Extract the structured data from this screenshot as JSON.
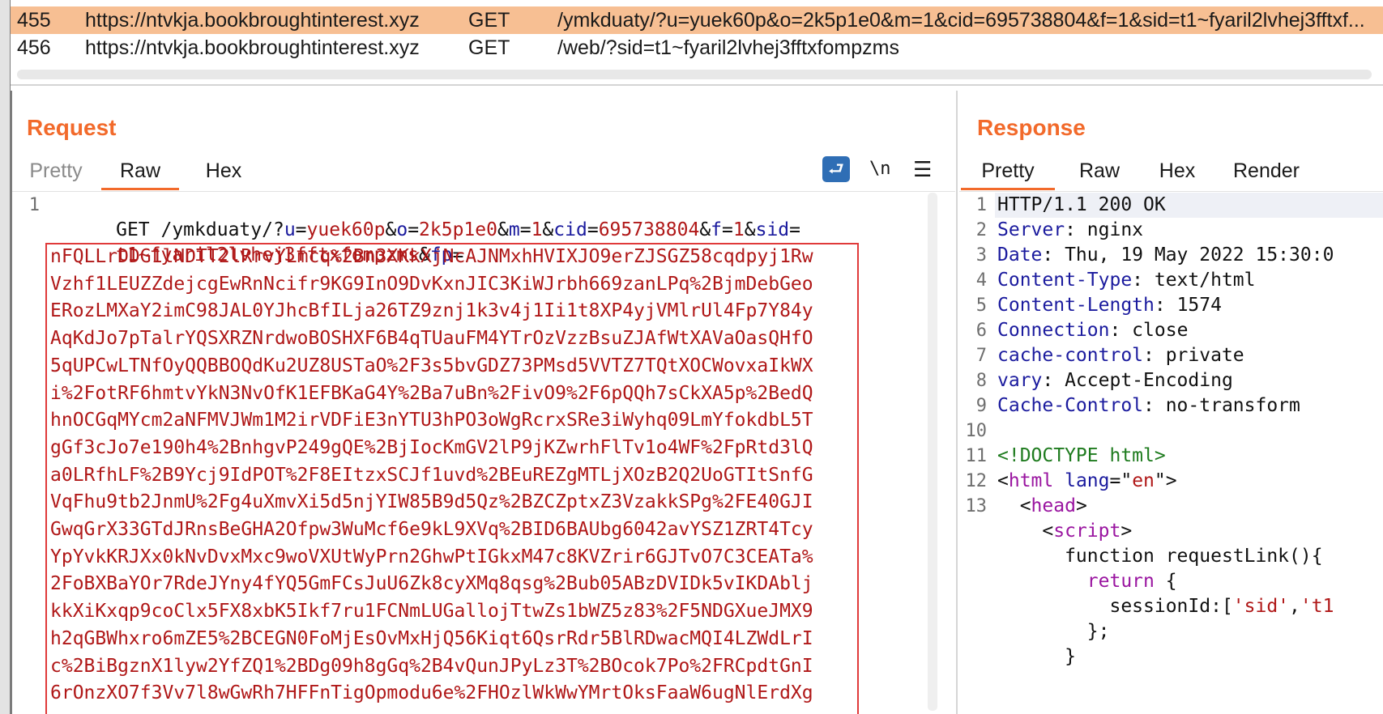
{
  "history": {
    "rows": [
      {
        "id": "455",
        "host": "https://ntvkja.bookbroughtinterest.xyz",
        "method": "GET",
        "url": "/ymkduaty/?u=yuek60p&o=2k5p1e0&m=1&cid=695738804&f=1&sid=t1~fyaril2lvhej3fftxf...",
        "selected": true
      },
      {
        "id": "456",
        "host": "https://ntvkja.bookbroughtinterest.xyz",
        "method": "GET",
        "url": "/web/?sid=t1~fyaril2lvhej3fftxfompzms",
        "selected": false
      }
    ]
  },
  "request": {
    "title": "Request",
    "tabs": [
      "Pretty",
      "Raw",
      "Hex"
    ],
    "active_tab": "Raw",
    "tools": {
      "wrap_icon": "wrap-lines-icon",
      "newline_label": "\\n",
      "menu_icon": "hamburger-menu-icon"
    },
    "line1_method": "GET /ymkduaty/?",
    "params": [
      {
        "k": "u",
        "v": "yuek60p"
      },
      {
        "k": "o",
        "v": "2k5p1e0"
      },
      {
        "k": "m",
        "v": "1"
      },
      {
        "k": "cid",
        "v": "695738804"
      },
      {
        "k": "f",
        "v": "1"
      },
      {
        "k": "sid",
        "v": ""
      }
    ],
    "line1_cont": "t1~fyaril2lvhej3fftxfompzms",
    "line1_cont_key": "fp",
    "fp_lines": [
      "nFQLLrDDG1lNDTT2lRrvYLmcq%2Bn3XKkXjNcAJNMxhHVIXJO9erZJSGZ58cqdpyj1Rw",
      "Vzhf1LEUZZdejcgEwRnNcifr9KG9InO9DvKxnJIC3KiWJrbh669zanLPq%2BjmDebGeo",
      "ERozLMXaY2imC98JAL0YJhcBfILja26TZ9znj1k3v4j1Ii1t8XP4yjVMlrUl4Fp7Y84y",
      "AqKdJo7pTalrYQSXRZNrdwoBOSHXF6B4qTUauFM4YTrOzVzzBsuZJAfWtXAVaOasQHfO",
      "5qUPCwLTNfOyQQBBOQdKu2UZ8USTaO%2F3s5bvGDZ73PMsd5VVTZ7TQtXOCWovxaIkWX",
      "i%2FotRF6hmtvYkN3NvOfK1EFBKaG4Y%2Ba7uBn%2FivO9%2F6pQQh7sCkXA5p%2BedQ",
      "hnOCGqMYcm2aNFMVJWm1M2irVDFiE3nYTU3hPO3oWgRcrxSRe3iWyhq09LmYfokdbL5T",
      "gGf3cJo7e190h4%2BnhgvP249gQE%2BjIocKmGV2lP9jKZwrhFlTv1o4WF%2FpRtd3lQ",
      "a0LRfhLF%2B9Ycj9IdPOT%2F8EItzxSCJf1uvd%2BEuREZgMTLjXOzB2Q2UoGTItSnfG",
      "VqFhu9tb2JnmU%2Fg4uXmvXi5d5njYIW85B9d5Qz%2BZCZptxZ3VzakkSPg%2FE40GJI",
      "GwqGrX33GTdJRnsBeGHA2Ofpw3WuMcf6e9kL9XVq%2BID6BAUbg6042avYSZ1ZRT4Tcy",
      "YpYvkKRJXx0kNvDvxMxc9woVXUtWyPrn2GhwPtIGkxM47c8KVZrir6GJTvO7C3CEATa%",
      "2FoBXBaYOr7RdeJYny4fYQ5GmFCsJuU6Zk8cyXMq8qsg%2Bub05ABzDVIDk5vIKDAblj",
      "kkXiKxqp9coClx5FX8xbK5Ikf7ru1FCNmLUGallojTtwZs1bWZ5z83%2F5NDGXueJMX9",
      "h2qGBWhxro6mZE5%2BCEGN0FoMjEsOvMxHjQ56Kiqt6QsrRdr5BlRDwacMQI4LZWdLrI",
      "c%2BiBgznX1lyw2YfZQ1%2BDg09h8gGq%2B4vQunJPyLz3T%2BOcok7Po%2FRCpdtGnI",
      "6rOnzXO7f3Vv7l8wGwRh7HFFnTigOpmodu6e%2FHOzlWkWwYMrtOksFaaW6ugNlErdXg"
    ]
  },
  "response": {
    "title": "Response",
    "tabs": [
      "Pretty",
      "Raw",
      "Hex",
      "Render"
    ],
    "active_tab": "Pretty",
    "lines": [
      {
        "n": "1",
        "parts": [
          {
            "c": "t",
            "s": "HTTP/1.1 200 OK"
          }
        ]
      },
      {
        "n": "2",
        "parts": [
          {
            "c": "k",
            "s": "Server"
          },
          {
            "c": "t",
            "s": ": nginx"
          }
        ]
      },
      {
        "n": "3",
        "parts": [
          {
            "c": "k",
            "s": "Date"
          },
          {
            "c": "t",
            "s": ": Thu, 19 May 2022 15:30:0"
          }
        ]
      },
      {
        "n": "4",
        "parts": [
          {
            "c": "k",
            "s": "Content-Type"
          },
          {
            "c": "t",
            "s": ": text/html"
          }
        ]
      },
      {
        "n": "5",
        "parts": [
          {
            "c": "k",
            "s": "Content-Length"
          },
          {
            "c": "t",
            "s": ": 1574"
          }
        ]
      },
      {
        "n": "6",
        "parts": [
          {
            "c": "k",
            "s": "Connection"
          },
          {
            "c": "t",
            "s": ": close"
          }
        ]
      },
      {
        "n": "7",
        "parts": [
          {
            "c": "k",
            "s": "cache-control"
          },
          {
            "c": "t",
            "s": ": private"
          }
        ]
      },
      {
        "n": "8",
        "parts": [
          {
            "c": "k",
            "s": "vary"
          },
          {
            "c": "t",
            "s": ": Accept-Encoding"
          }
        ]
      },
      {
        "n": "9",
        "parts": [
          {
            "c": "k",
            "s": "Cache-Control"
          },
          {
            "c": "t",
            "s": ": no-transform"
          }
        ]
      },
      {
        "n": "10",
        "parts": []
      },
      {
        "n": "11",
        "parts": [
          {
            "c": "g",
            "s": "<!DOCTYPE html>"
          }
        ]
      },
      {
        "n": "12",
        "parts": [
          {
            "c": "t",
            "s": "<"
          },
          {
            "c": "p",
            "s": "html"
          },
          {
            "c": "k",
            "s": " lang"
          },
          {
            "c": "t",
            "s": "=\""
          },
          {
            "c": "v",
            "s": "en"
          },
          {
            "c": "t",
            "s": "\">"
          }
        ]
      },
      {
        "n": "13",
        "parts": [
          {
            "c": "t",
            "s": "  <"
          },
          {
            "c": "p",
            "s": "head"
          },
          {
            "c": "t",
            "s": ">"
          }
        ]
      },
      {
        "n": "",
        "parts": [
          {
            "c": "t",
            "s": "    <"
          },
          {
            "c": "p",
            "s": "script"
          },
          {
            "c": "t",
            "s": ">"
          }
        ]
      },
      {
        "n": "",
        "parts": [
          {
            "c": "t",
            "s": "      function requestLink(){"
          }
        ]
      },
      {
        "n": "",
        "parts": [
          {
            "c": "t",
            "s": "        "
          },
          {
            "c": "p",
            "s": "return"
          },
          {
            "c": "t",
            "s": " {"
          }
        ]
      },
      {
        "n": "",
        "parts": [
          {
            "c": "t",
            "s": "          sessionId:["
          },
          {
            "c": "v",
            "s": "'sid'"
          },
          {
            "c": "t",
            "s": ","
          },
          {
            "c": "v",
            "s": "'t1"
          }
        ]
      },
      {
        "n": "",
        "parts": [
          {
            "c": "t",
            "s": "        };"
          }
        ]
      },
      {
        "n": "",
        "parts": [
          {
            "c": "t",
            "s": "      }"
          }
        ]
      }
    ]
  }
}
